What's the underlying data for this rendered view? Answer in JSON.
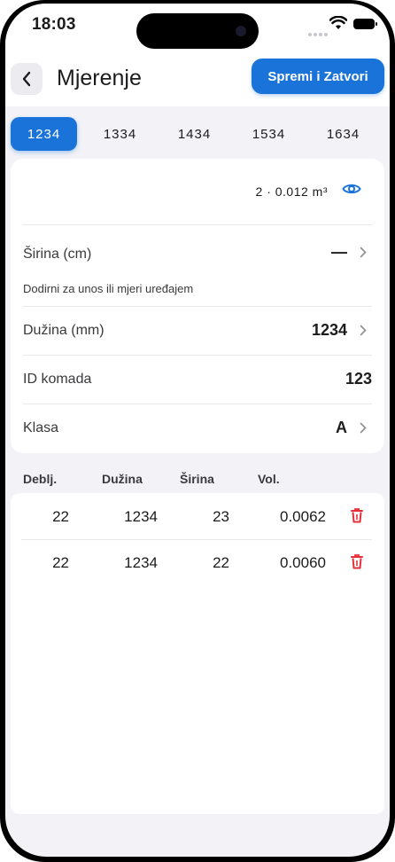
{
  "status": {
    "time": "18:03"
  },
  "nav": {
    "title": "Mjerenje",
    "save_label": "Spremi i Zatvori"
  },
  "tabs": [
    "1234",
    "1334",
    "1434",
    "1534",
    "1634"
  ],
  "active_tab": "1234",
  "summary": {
    "text": "2 · 0.012 m³"
  },
  "fields": {
    "sirina": {
      "label": "Širina (cm)",
      "value": "—",
      "hint": "Dodirni za unos ili mjeri uređajem"
    },
    "duzina": {
      "label": "Dužina (mm)",
      "value": "1234"
    },
    "id": {
      "label": "ID komada",
      "value": "123"
    },
    "klasa": {
      "label": "Klasa",
      "value": "A"
    }
  },
  "table": {
    "headers": [
      "Deblj.",
      "Dužina",
      "Širina",
      "Vol."
    ],
    "rows": [
      [
        "22",
        "1234",
        "23",
        "0.0062"
      ],
      [
        "22",
        "1234",
        "22",
        "0.0060"
      ]
    ]
  },
  "colors": {
    "accent": "#1a73d8",
    "danger": "#e5303a",
    "background": "#f2f2f7"
  },
  "icons": {
    "back": "chevron-left-icon",
    "view": "eye-icon",
    "row": "chevron-right-icon",
    "delete": "trash-icon"
  }
}
